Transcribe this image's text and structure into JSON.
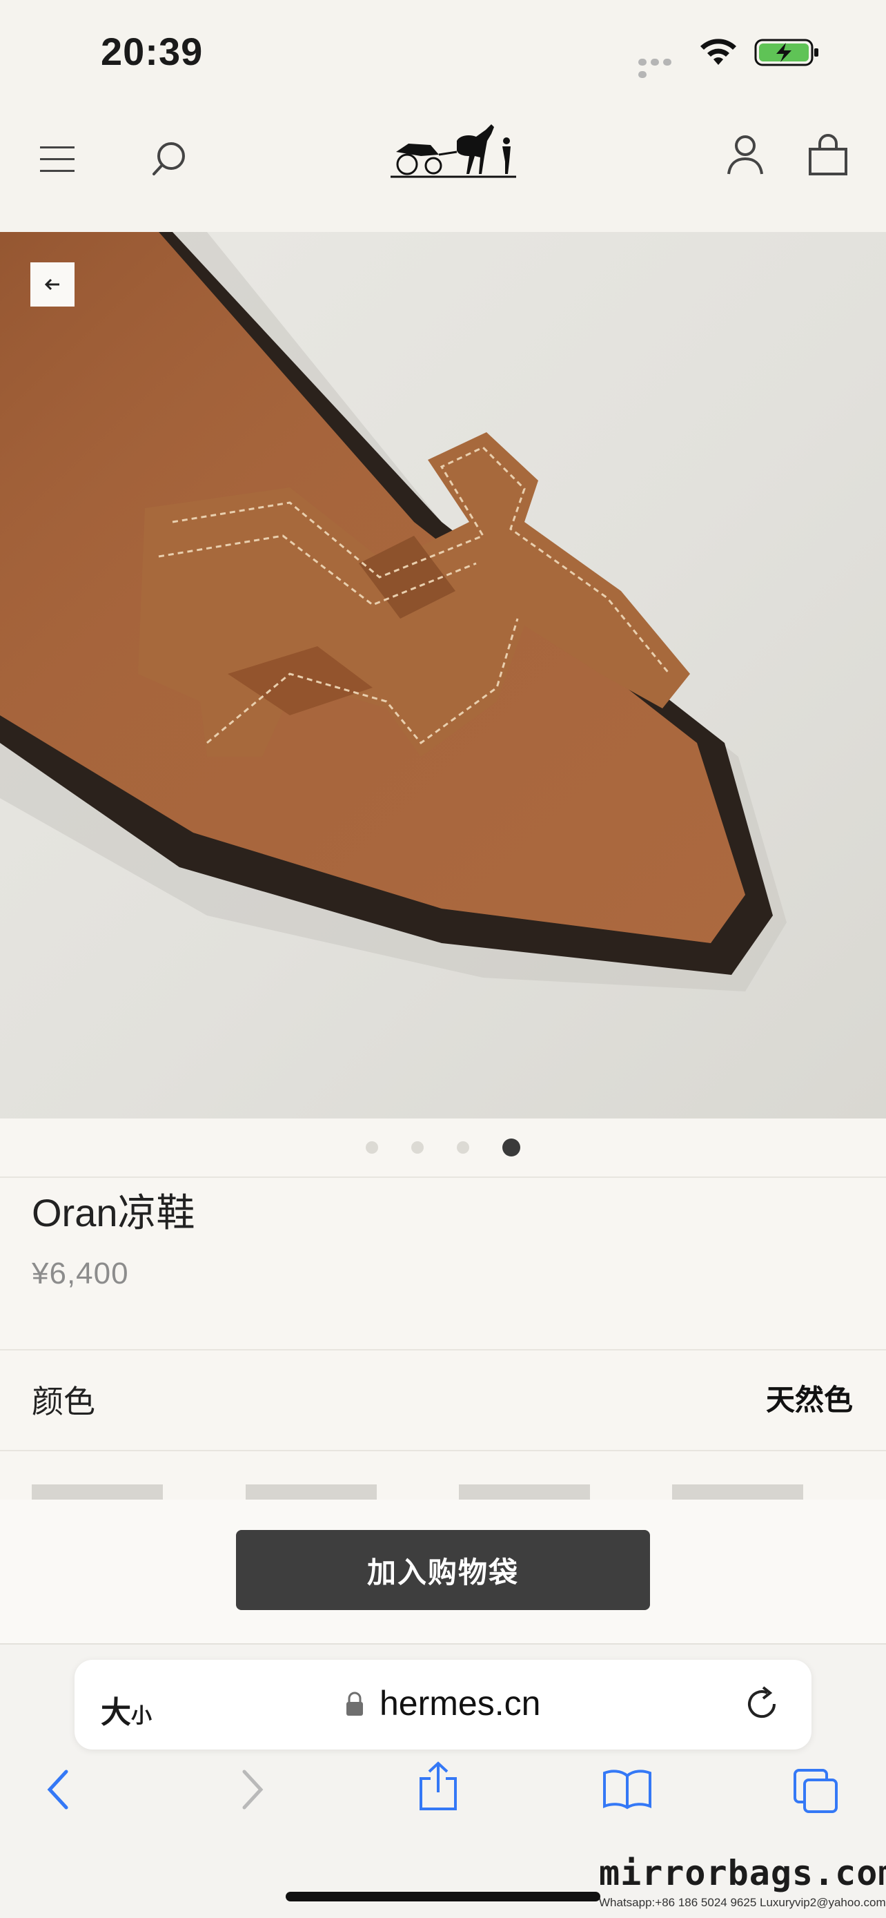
{
  "status_bar": {
    "time": "20:39"
  },
  "header": {
    "menu_icon": "menu-icon",
    "search_icon": "search-icon",
    "logo": "hermes-carriage-logo",
    "account_icon": "user-icon",
    "bag_icon": "shopping-bag-icon"
  },
  "gallery": {
    "slide_count": 4,
    "active_index": 3
  },
  "product": {
    "title": "Oran凉鞋",
    "price": "¥6,400",
    "color_label": "颜色",
    "color_value": "天然色"
  },
  "cta": {
    "label": "加入购物袋"
  },
  "safari": {
    "text_size_label": "大",
    "text_size_small": "小",
    "domain": "hermes.cn"
  },
  "watermark": {
    "main": "mirrorbags.com",
    "contact": "Whatsapp:+86 186 5024 9625   Luxuryvip2@yahoo.com"
  },
  "colors": {
    "accent": "#3e3e3e",
    "leather": "#a8683c",
    "background": "#f8f6f2",
    "safari_blue": "#3478f6"
  }
}
